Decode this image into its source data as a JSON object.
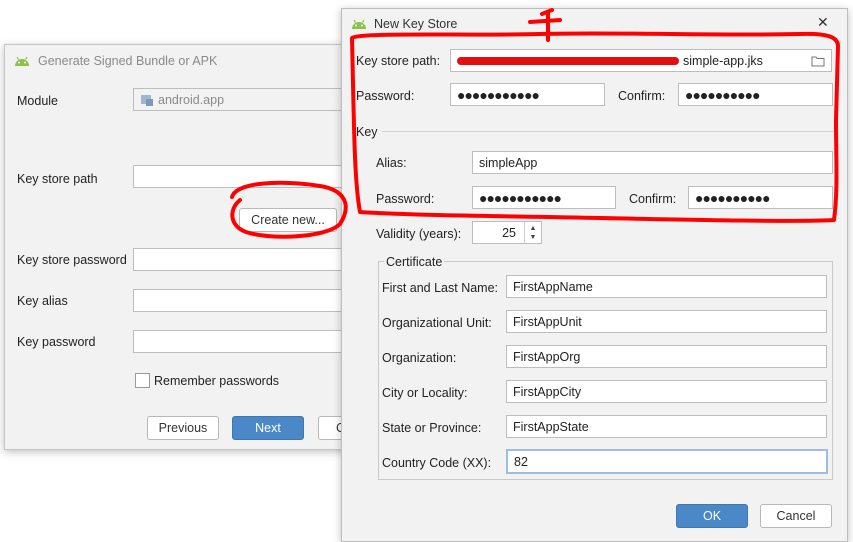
{
  "bg_dialog": {
    "title": "Generate Signed Bundle or APK",
    "module_label": "Module",
    "module_value": "android.app",
    "key_store_path_label": "Key store path",
    "create_new_label": "Create new...",
    "key_store_password_label": "Key store password",
    "key_alias_label": "Key alias",
    "key_password_label": "Key password",
    "remember_label": "Remember passwords",
    "previous_label": "Previous",
    "next_label": "Next",
    "cancel_partial": "C"
  },
  "keystore_dialog": {
    "title": "New Key Store",
    "close_glyph": "✕",
    "key_store_path_label": "Key store path:",
    "key_store_path_value": "simple-app.jks",
    "password_label": "Password:",
    "password_value": "●●●●●●●●●●●",
    "confirm_label": "Confirm:",
    "confirm_value": "●●●●●●●●●●",
    "key_section_label": "Key",
    "alias_label": "Alias:",
    "alias_value": "simpleApp",
    "key_password_label": "Password:",
    "key_password_value": "●●●●●●●●●●●",
    "key_confirm_label": "Confirm:",
    "key_confirm_value": "●●●●●●●●●●",
    "validity_label": "Validity (years):",
    "validity_value": "25",
    "certificate_label": "Certificate",
    "cert_fields": [
      {
        "label": "First and Last Name:",
        "value": "FirstAppName"
      },
      {
        "label": "Organizational Unit:",
        "value": "FirstAppUnit"
      },
      {
        "label": "Organization:",
        "value": "FirstAppOrg"
      },
      {
        "label": "City or Locality:",
        "value": "FirstAppCity"
      },
      {
        "label": "State or Province:",
        "value": "FirstAppState"
      },
      {
        "label": "Country Code (XX):",
        "value": "82"
      }
    ],
    "ok_label": "OK",
    "cancel_label": "Cancel"
  },
  "annotation_color": "#ff0000",
  "icons": [
    "android-icon",
    "folder-icon",
    "module-icon",
    "close-icon",
    "spinner-up-icon",
    "spinner-down-icon",
    "checkbox-icon"
  ]
}
